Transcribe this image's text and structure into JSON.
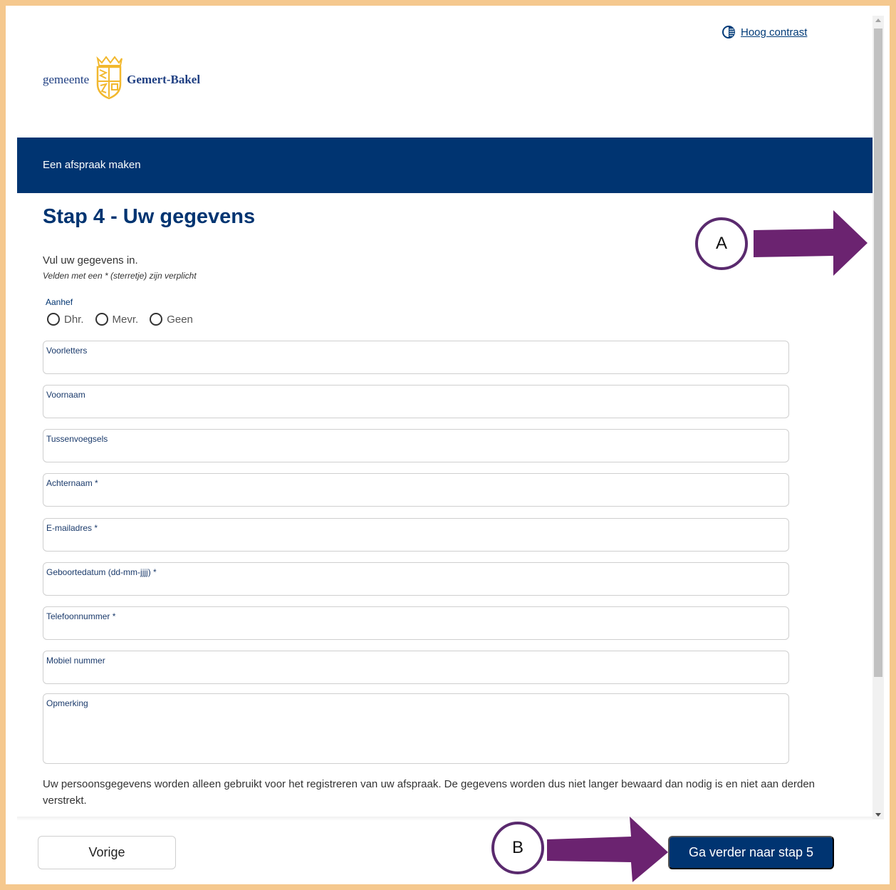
{
  "header": {
    "contrast_link": "Hoog contrast",
    "logo": {
      "prefix": "gemeente",
      "name": "Gemert-Bakel"
    },
    "nav_title": "Een afspraak maken"
  },
  "page": {
    "title": "Stap 4 - Uw gegevens",
    "intro": "Vul uw gegevens in.",
    "required_note": "Velden met een * (sterretje) zijn verplicht"
  },
  "form": {
    "aanhef": {
      "label": "Aanhef",
      "options": [
        "Dhr.",
        "Mevr.",
        "Geen"
      ]
    },
    "fields": [
      {
        "label": "Voorletters",
        "value": ""
      },
      {
        "label": "Voornaam",
        "value": ""
      },
      {
        "label": "Tussenvoegsels",
        "value": ""
      },
      {
        "label": "Achternaam *",
        "value": ""
      },
      {
        "label": "E-mailadres *",
        "value": ""
      },
      {
        "label": "Geboortedatum (dd-mm-jjjj) *",
        "value": ""
      },
      {
        "label": "Telefoonnummer *",
        "value": ""
      },
      {
        "label": "Mobiel nummer",
        "value": ""
      },
      {
        "label": "Opmerking",
        "value": ""
      }
    ]
  },
  "privacy_text": "Uw persoonsgegevens worden alleen gebruikt voor het registreren van uw afspraak. De gegevens worden dus niet langer bewaard dan nodig is en niet aan derden verstrekt.",
  "footer": {
    "prev_label": "Vorige",
    "next_label": "Ga verder naar stap 5"
  },
  "annotations": {
    "marker_a": "A",
    "marker_b": "B",
    "color": "#6b2370"
  },
  "colors": {
    "brand_blue": "#003471",
    "logo_gold": "#f2b82e",
    "frame_border": "#f5c88e"
  },
  "icons": {
    "contrast": "contrast-icon",
    "crest": "crest-icon"
  }
}
